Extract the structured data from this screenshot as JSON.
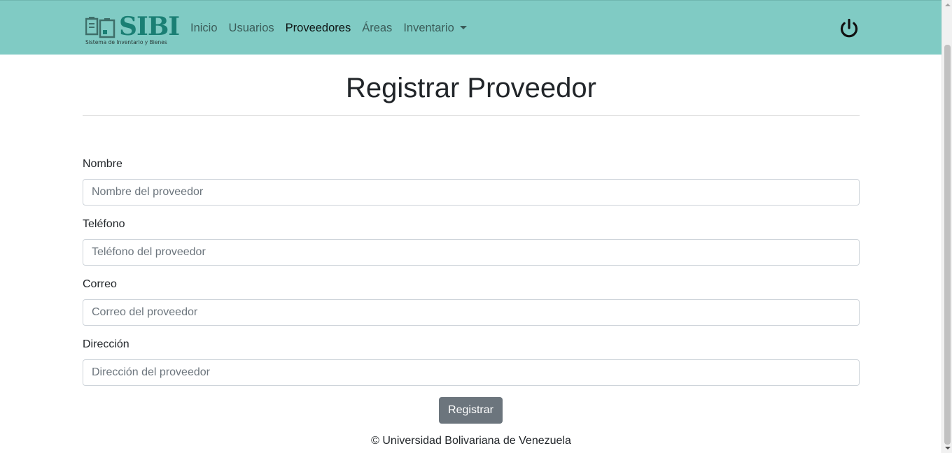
{
  "colors": {
    "navbar_bg": "#80cbc4",
    "brand_accent": "#1a7f74",
    "button_bg": "#6c757d"
  },
  "brand": {
    "title": "SIBI",
    "subtitle": "Sistema de Inventario y Bienes",
    "icon": "clipboard-icon"
  },
  "nav": {
    "items": [
      {
        "label": "Inicio"
      },
      {
        "label": "Usuarios"
      },
      {
        "label": "Proveedores"
      },
      {
        "label": "Áreas"
      },
      {
        "label": "Inventario"
      }
    ],
    "active": "Proveedores",
    "logout_icon": "power-icon"
  },
  "page": {
    "title": "Registrar Proveedor"
  },
  "form": {
    "fields": [
      {
        "label": "Nombre",
        "placeholder": "Nombre del proveedor",
        "value": ""
      },
      {
        "label": "Teléfono",
        "placeholder": "Teléfono del proveedor",
        "value": ""
      },
      {
        "label": "Correo",
        "placeholder": "Correo del proveedor",
        "value": ""
      },
      {
        "label": "Dirección",
        "placeholder": "Dirección del proveedor",
        "value": ""
      }
    ],
    "submit_label": "Registrar"
  },
  "footer": {
    "text": "© Universidad Bolivariana de Venezuela"
  }
}
